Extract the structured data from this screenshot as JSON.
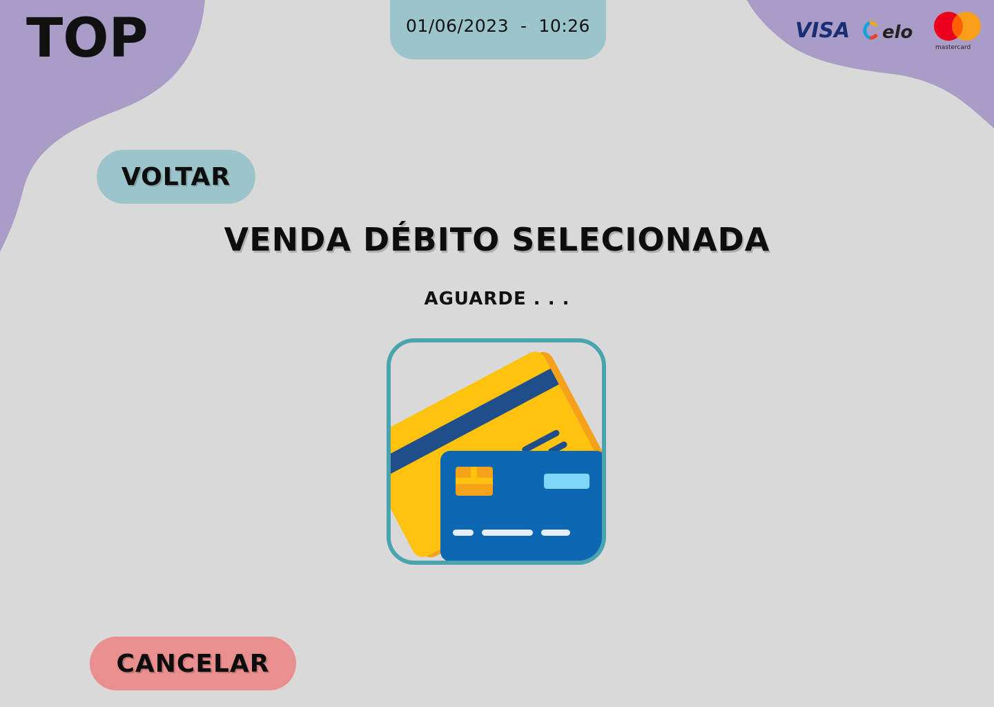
{
  "header": {
    "logo_text": "TOP",
    "datetime": "01/06/2023  -  10:26",
    "brands": {
      "visa": "VISA",
      "elo": "elo",
      "mastercard": "mastercard"
    }
  },
  "actions": {
    "back_label": "VOLTAR",
    "cancel_label": "CANCELAR"
  },
  "main": {
    "title": "VENDA DÉBITO SELECIONADA",
    "status": "AGUARDE . . ."
  },
  "colors": {
    "background": "#d9d9d9",
    "blob": "#a99cc6",
    "accent_teal": "#9cc4cb",
    "frame_teal": "#4aa4b0",
    "cancel_red": "#e98f8f"
  }
}
